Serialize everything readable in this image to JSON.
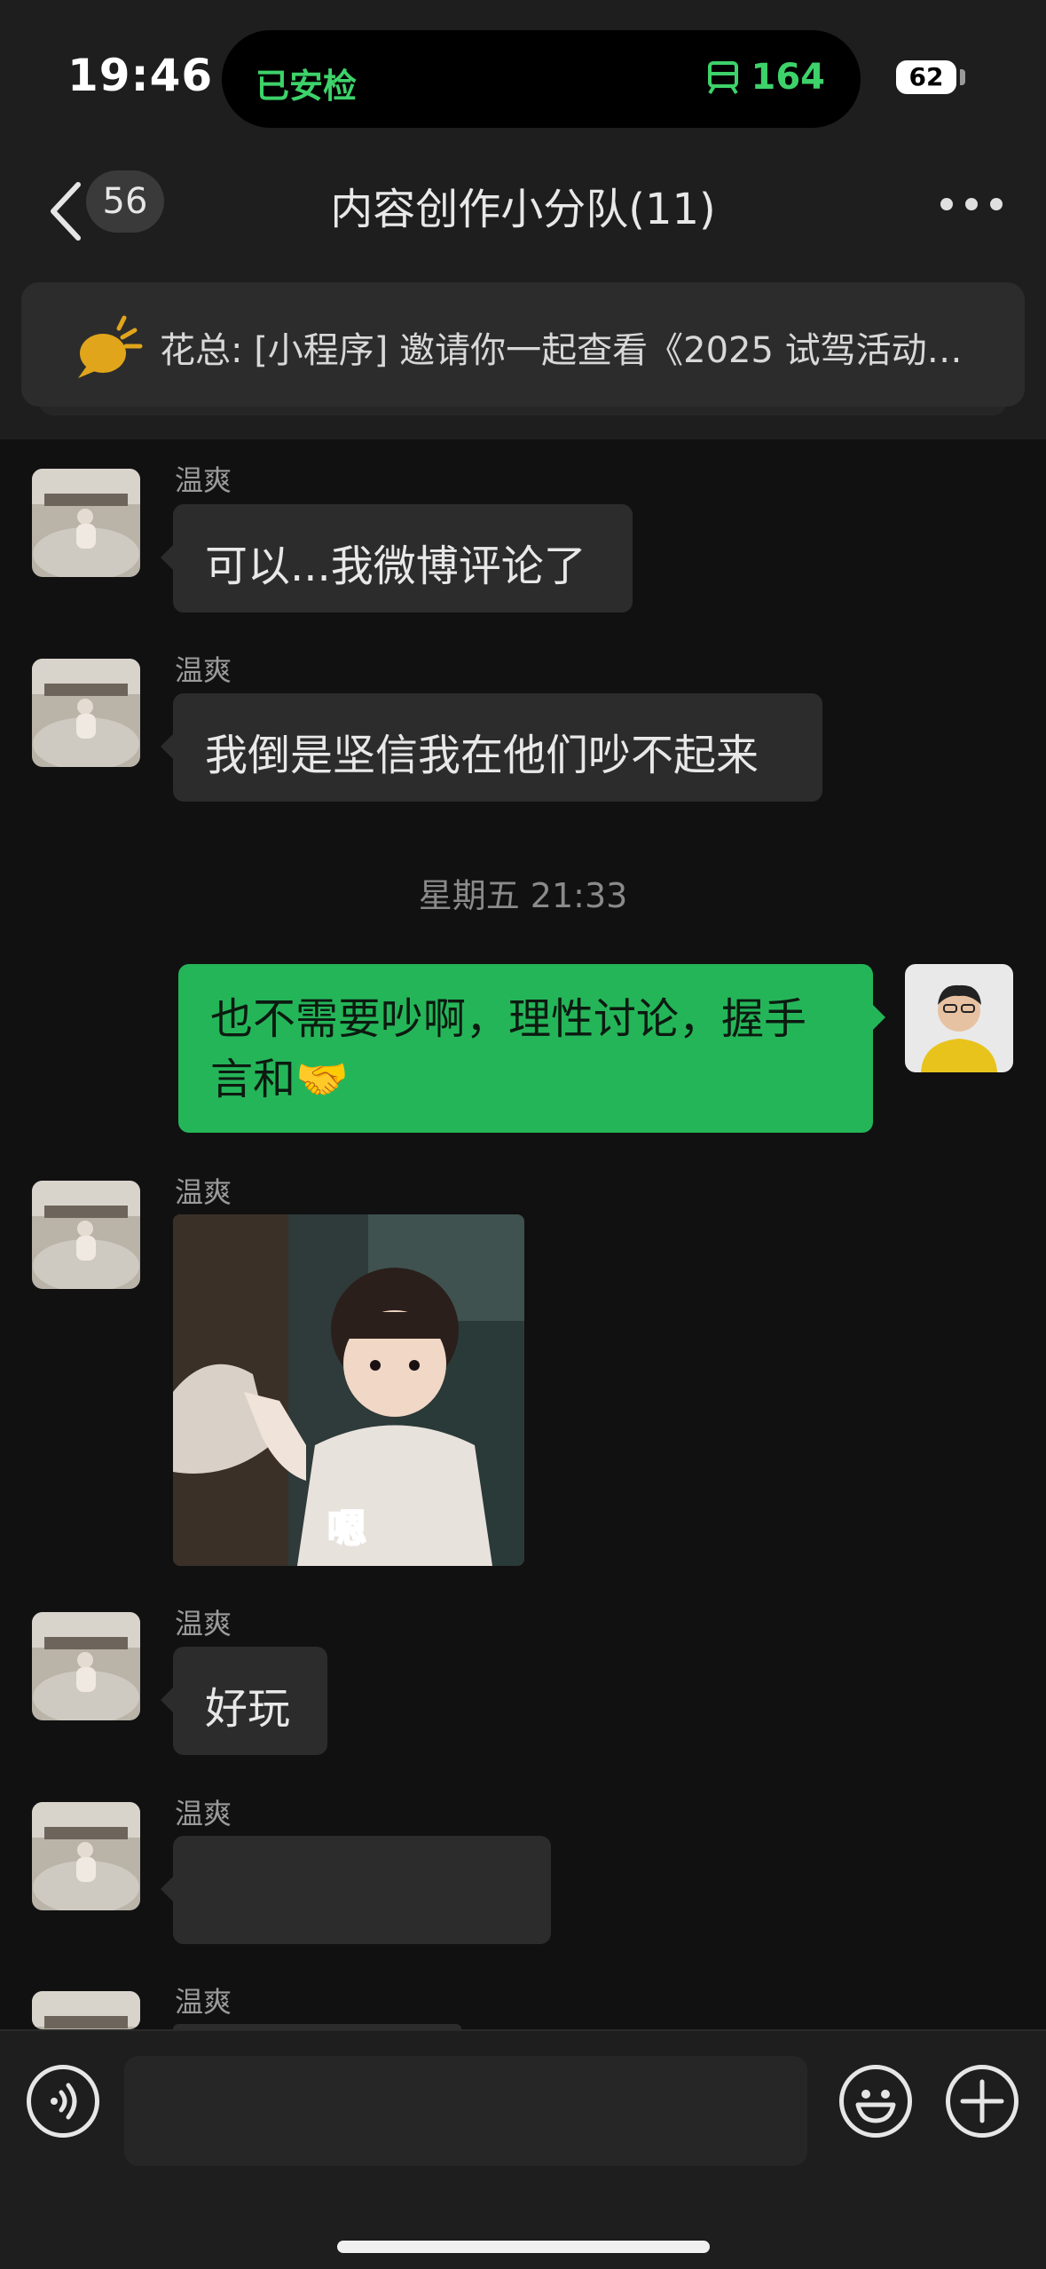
{
  "status_bar": {
    "time": "19:46",
    "island_left": "已安检",
    "island_right_value": "164",
    "battery": "62"
  },
  "nav": {
    "unread_count": "56",
    "title": "内容创作小分队(11)"
  },
  "announcement": {
    "text": "花总: [小程序] 邀请你一起查看《2025 试驾活动…"
  },
  "messages": [
    {
      "sender": "温爽",
      "type": "text",
      "text": "可以...我微博评论了"
    },
    {
      "sender": "温爽",
      "type": "text",
      "text": "我倒是坚信我在他们吵不起来"
    },
    {
      "type": "time",
      "text": "星期五 21:33"
    },
    {
      "sender": "me",
      "type": "text",
      "text": "也不需要吵啊，理性讨论，握手言和🤝"
    },
    {
      "sender": "温爽",
      "type": "sticker",
      "caption": "嗯"
    },
    {
      "sender": "温爽",
      "type": "text",
      "text": "好玩"
    },
    {
      "sender": "温爽",
      "type": "text",
      "text": ""
    },
    {
      "sender": "温爽",
      "type": "text",
      "text": ""
    }
  ],
  "icons": {
    "back": "chevron-left-icon",
    "more": "more-dots-icon",
    "voice": "voice-icon",
    "emoji": "emoji-icon",
    "plus": "plus-icon",
    "announcement": "megaphone-icon",
    "metro": "metro-icon"
  },
  "colors": {
    "accent_green": "#25b559",
    "status_green": "#3dd26a",
    "background": "#111111",
    "bar": "#1e1e1e",
    "bubble_in": "#2c2c2c"
  }
}
